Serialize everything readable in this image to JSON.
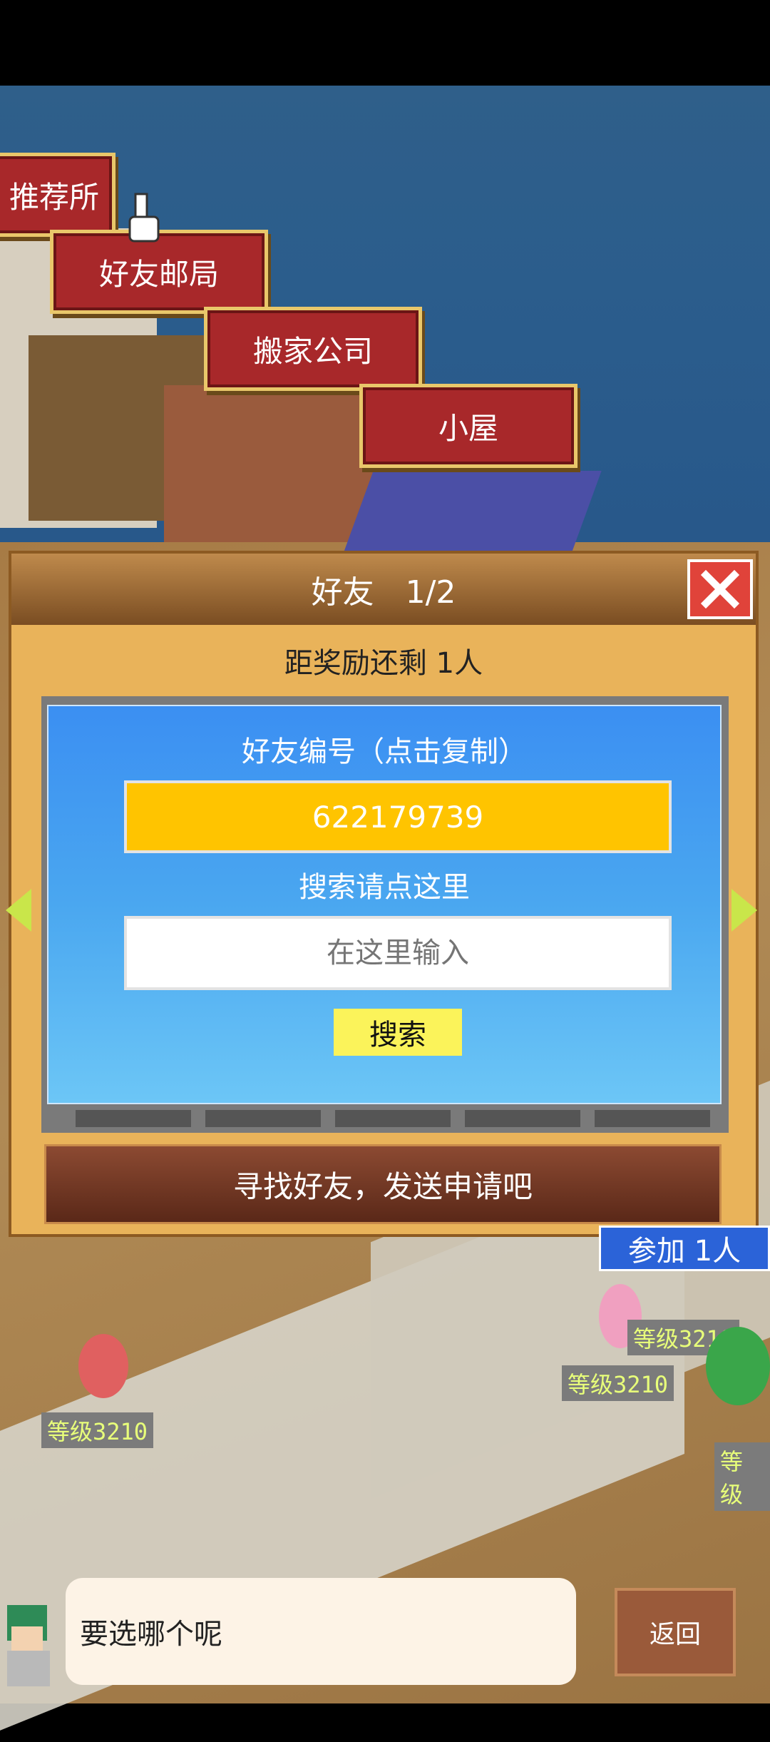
{
  "map_buttons": {
    "recommend": "推荐所",
    "post_office": "好友邮局",
    "moving_company": "搬家公司",
    "cottage": "小屋"
  },
  "dialog": {
    "title": "好友　1/2",
    "reward_text": "距奖励还剩 1人",
    "id_label": "好友编号（点击复制）",
    "friend_id": "622179739",
    "search_hint": "搜索请点这里",
    "search_placeholder": "在这里输入",
    "search_button": "搜索",
    "banner": "寻找好友，发送申请吧"
  },
  "join_badge": "参加 1人",
  "level_tags": [
    "等级3210",
    "等级3210",
    "等级3210",
    "等级"
  ],
  "chat": {
    "message": "要选哪个呢"
  },
  "back_button": "返回",
  "colors": {
    "dialog_bg": "#e9b35a",
    "panel_blue": "#3b8ff2",
    "id_box": "#ffc400",
    "search_btn": "#fbf35a",
    "map_button": "#a8282a"
  }
}
